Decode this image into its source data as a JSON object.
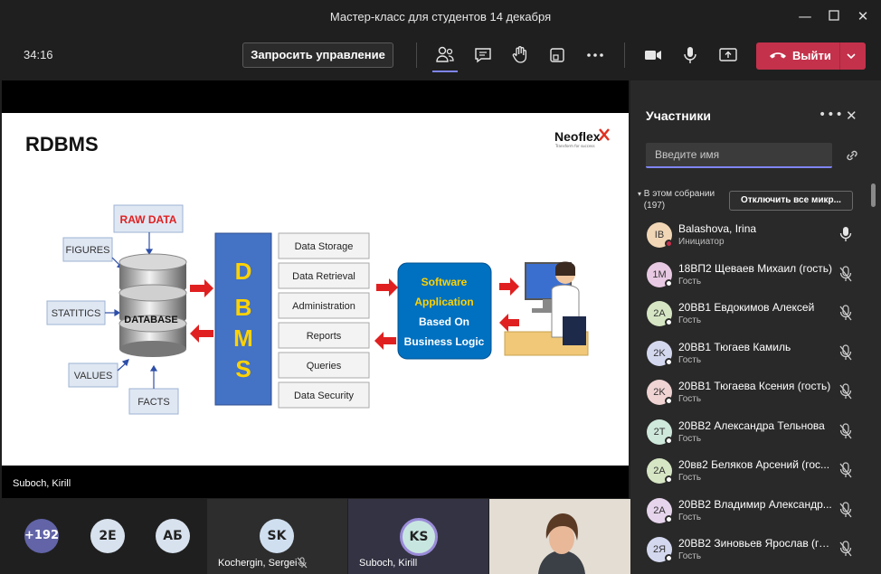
{
  "window": {
    "title": "Мастер-класс для студентов 14 декабря"
  },
  "toolbar": {
    "timer": "34:16",
    "request_control": "Запросить управление",
    "leave_label": "Выйти"
  },
  "slide": {
    "title": "RDBMS",
    "logo": "Neoflex",
    "logo_sub": "Transform for success",
    "inputs": [
      "RAW DATA",
      "FIGURES",
      "STATITICS",
      "VALUES",
      "FACTS"
    ],
    "db_label": "DATABASE",
    "dbms_letters": [
      "D",
      "B",
      "M",
      "S"
    ],
    "functions": [
      "Data Storage",
      "Data Retrieval",
      "Administration",
      "Reports",
      "Queries",
      "Data Security"
    ],
    "app_lines": [
      "Software",
      "Application",
      "Based On",
      "Business Logic"
    ]
  },
  "stage": {
    "speaker": "Suboch, Kirill"
  },
  "strip": {
    "overflow": "+192",
    "avatars": [
      "2E",
      "АБ"
    ],
    "tiles": [
      {
        "initials": "SK",
        "name": "Kochergin, Sergei"
      },
      {
        "initials": "KS",
        "name": "Suboch, Kirill"
      }
    ]
  },
  "panel": {
    "title": "Участники",
    "search_placeholder": "Введите имя",
    "section_label": "В этом собрании (197)",
    "mute_all": "Отключить все микр...",
    "participants": [
      {
        "initials": "IB",
        "name": "Balashova, Irina",
        "role": "Инициатор",
        "color": "#f2d7b6",
        "status": "red"
      },
      {
        "initials": "1M",
        "name": "18ВП2 Щеваев Михаил (гость)",
        "role": "Гость",
        "color": "#e8c9e3",
        "status": "white"
      },
      {
        "initials": "2A",
        "name": "20ВВ1 Евдокимов Алексей",
        "role": "Гость",
        "color": "#d6e6c4",
        "status": "white"
      },
      {
        "initials": "2K",
        "name": "20ВВ1 Тюгаев Камиль",
        "role": "Гость",
        "color": "#d4d8ef",
        "status": "white"
      },
      {
        "initials": "2K",
        "name": "20ВВ1 Тюгаева Ксения (гость)",
        "role": "Гость",
        "color": "#f0d3d3",
        "status": "white"
      },
      {
        "initials": "2T",
        "name": "20ВВ2 Александра Тельнова",
        "role": "Гость",
        "color": "#cfe8dc",
        "status": "white"
      },
      {
        "initials": "2A",
        "name": "20вв2 Беляков Арсений (гос...",
        "role": "Гость",
        "color": "#d6e6c4",
        "status": "white"
      },
      {
        "initials": "2A",
        "name": "20ВВ2 Владимир Александр...",
        "role": "Гость",
        "color": "#e6d4ec",
        "status": "white"
      },
      {
        "initials": "2Я",
        "name": "20ВВ2 Зиновьев Ярослав (го...",
        "role": "Гость",
        "color": "#d4d8ef",
        "status": "white"
      }
    ]
  },
  "colors": {
    "accent": "#7f85f5",
    "leave": "#c4314b",
    "dbms_blue": "#4472c4",
    "app_blue": "#0070c0"
  }
}
